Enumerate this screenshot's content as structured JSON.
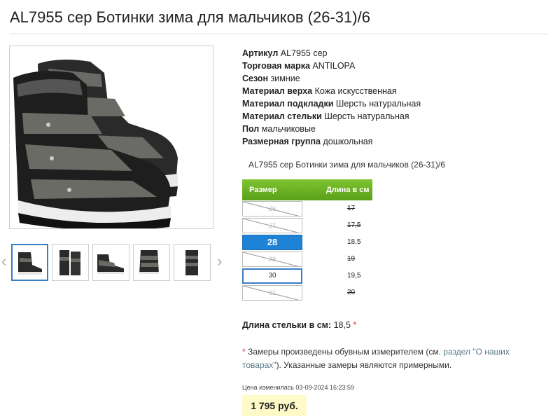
{
  "product": {
    "title": "AL7955 сер Ботинки зима для мальчиков (26-31)/6",
    "caption": "AL7955 сер Ботинки зима для мальчиков (26-31)/6"
  },
  "specs": [
    {
      "label": "Артикул",
      "value": "AL7955 сер"
    },
    {
      "label": "Торговая марка",
      "value": "ANTILOPA"
    },
    {
      "label": "Сезон",
      "value": "зимние"
    },
    {
      "label": "Материал верха",
      "value": "Кожа искусственная"
    },
    {
      "label": "Материал подкладки",
      "value": "Шерсть натуральная"
    },
    {
      "label": "Материал стельки",
      "value": "Шерсть натуральная"
    },
    {
      "label": "Пол",
      "value": "мальчиковые"
    },
    {
      "label": "Размерная группа",
      "value": "дошкольная"
    }
  ],
  "size_table": {
    "header_size": "Размер",
    "header_length": "Длина в см",
    "rows": [
      {
        "size": "26",
        "length": "17",
        "state": "disabled"
      },
      {
        "size": "27",
        "length": "17,5",
        "state": "disabled"
      },
      {
        "size": "28",
        "length": "18,5",
        "state": "selected"
      },
      {
        "size": "29",
        "length": "19",
        "state": "disabled"
      },
      {
        "size": "30",
        "length": "19,5",
        "state": "available"
      },
      {
        "size": "31",
        "length": "20",
        "state": "disabled"
      }
    ]
  },
  "insole": {
    "label": "Длина стельки в см:",
    "value": "18,5",
    "mark": "*"
  },
  "note": {
    "star": "*",
    "text1": " Замеры произведены обувным измерителем (см. ",
    "link": "раздел \"О наших товарах\"",
    "text2": "). Указанные замеры являются примерными."
  },
  "price_date": "Цена изменилась 03-09-2024 16:23:59",
  "price": "1 795 руб.",
  "gallery": {
    "prev_icon": "chevron-left-icon",
    "next_icon": "chevron-right-icon",
    "thumb_count": 5,
    "active_index": 0
  },
  "colors": {
    "header_green": "#6db327",
    "selected_blue": "#1e83d6",
    "price_bg": "#fffbc8",
    "required_red": "#e03030"
  }
}
